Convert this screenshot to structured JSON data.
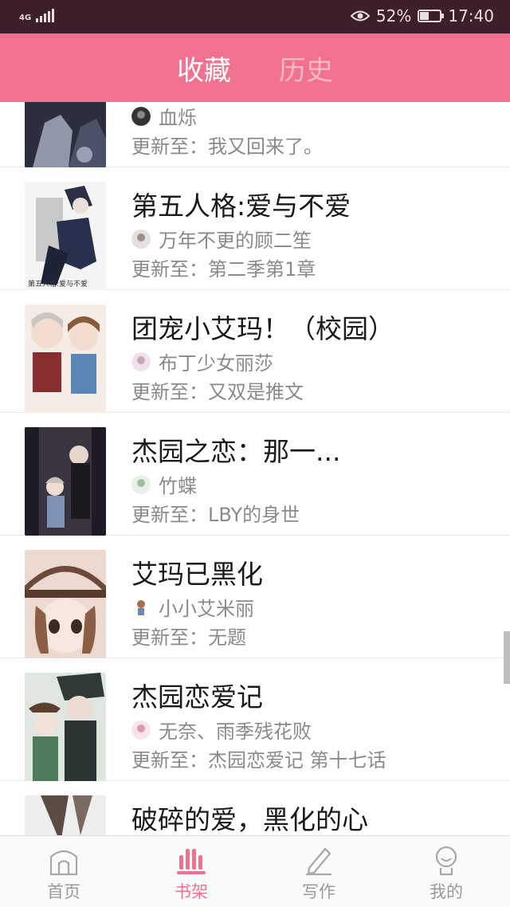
{
  "status_bar": {
    "network": "4G",
    "battery": "52%",
    "battery_level": 0.52,
    "time": "17:40"
  },
  "header": {
    "tabs": [
      {
        "label": "收藏",
        "active": true
      },
      {
        "label": "历史",
        "active": false
      }
    ]
  },
  "list": {
    "items": [
      {
        "title": "",
        "author": "血烁",
        "update_prefix": "更新至：",
        "update": "我又回来了。"
      },
      {
        "title": "第五人格:爱与不爱",
        "author": "万年不更的顾二笙",
        "update_prefix": "更新至：",
        "update": "第二季第1章",
        "cover_caption": "第五人格:爱与不爱"
      },
      {
        "title": "团宠小艾玛！（校园）",
        "author": "布丁少女丽莎",
        "update_prefix": "更新至：",
        "update": "又双是推文"
      },
      {
        "title": "杰园之恋：那一...",
        "author": "竹蝶",
        "update_prefix": "更新至：",
        "update": "LBY的身世"
      },
      {
        "title": "艾玛已黑化",
        "author": "小小艾米丽",
        "update_prefix": "更新至：",
        "update": "无题"
      },
      {
        "title": "杰园恋爱记",
        "author": "无奈、雨季残花败",
        "update_prefix": "更新至：",
        "update": "杰园恋爱记 第十七话"
      },
      {
        "title": "破碎的爱，黑化的心",
        "author": "",
        "update_prefix": "",
        "update": ""
      }
    ]
  },
  "bottom_nav": {
    "items": [
      {
        "label": "首页",
        "icon": "home-icon",
        "active": false
      },
      {
        "label": "书架",
        "icon": "bookshelf-icon",
        "active": true
      },
      {
        "label": "写作",
        "icon": "pen-icon",
        "active": false
      },
      {
        "label": "我的",
        "icon": "profile-icon",
        "active": false
      }
    ]
  },
  "colors": {
    "accent": "#f0728f",
    "status_bar": "#3d1f2a",
    "muted_text": "#8a8a8a"
  }
}
